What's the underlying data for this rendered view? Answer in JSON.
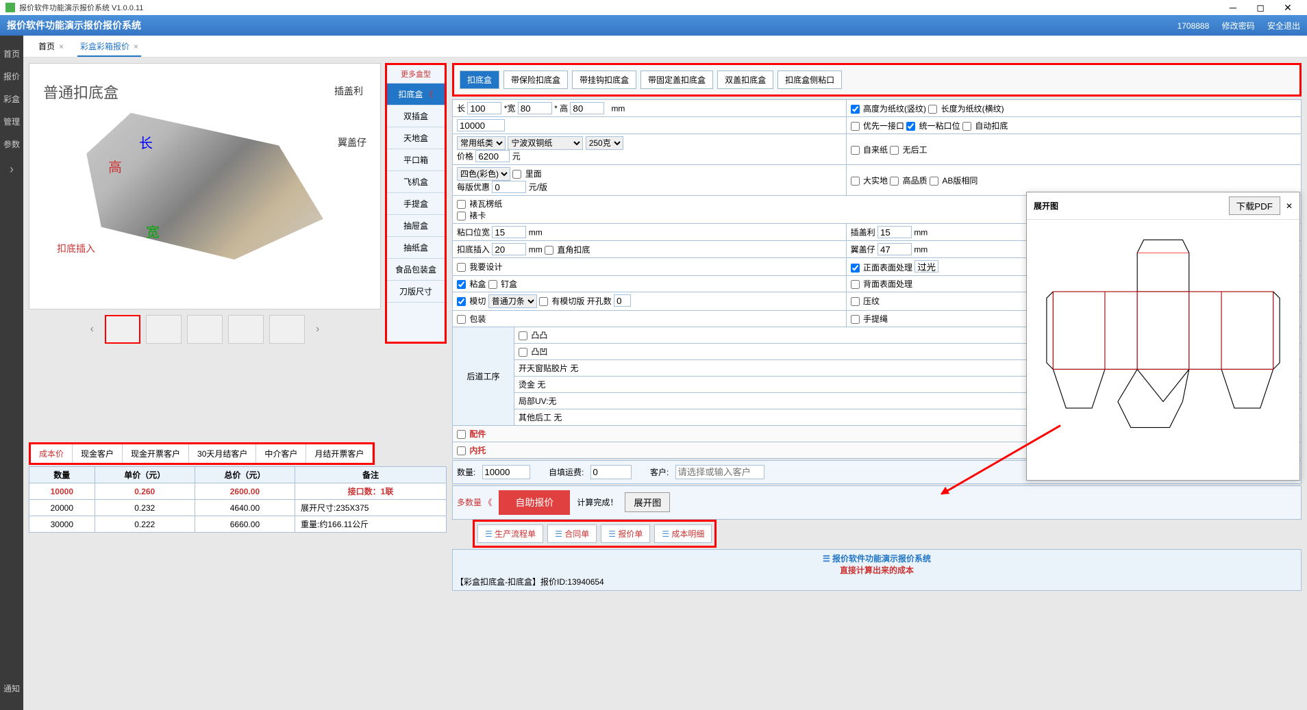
{
  "titlebar": {
    "title": "报价软件功能演示报价系统 V1.0.0.11"
  },
  "header": {
    "brand": "报价软件功能演示报价报价系统",
    "user_id": "1708888",
    "change_pwd": "修改密码",
    "logout": "安全退出"
  },
  "sidebar": {
    "items": [
      "首页",
      "报价",
      "彩盒",
      "管理",
      "参数"
    ],
    "notice": "通知"
  },
  "tabs": [
    {
      "label": "首页",
      "active": false
    },
    {
      "label": "彩盒彩箱报价",
      "active": true
    }
  ],
  "preview": {
    "title": "普通扣底盒",
    "anno_top_right": "插盖利",
    "anno_right": "翼盖仔",
    "anno_length": "长",
    "anno_height": "高",
    "anno_width": "宽",
    "anno_bottom": "扣底插入"
  },
  "box_types": {
    "more": "更多盒型",
    "items": [
      "扣底盒",
      "双插盒",
      "天地盒",
      "平口箱",
      "飞机盒",
      "手提盒",
      "抽屉盒",
      "抽纸盒",
      "食品包装盒",
      "刀版尺寸"
    ],
    "active": 0
  },
  "subtypes": {
    "items": [
      "扣底盒",
      "带保险扣底盒",
      "带挂钩扣底盒",
      "带固定盖扣底盒",
      "双盖扣底盒",
      "扣底盒侧粘口"
    ],
    "active": 0
  },
  "form": {
    "length_label": "长",
    "length": "100",
    "width_label_prefix": "*宽",
    "width": "80",
    "height_label_prefix": "* 高",
    "height": "80",
    "unit_mm": "mm",
    "height_vert": "高度为纸纹(竖纹)",
    "height_horiz": "长度为纸纹(横纹)",
    "qty": "10000",
    "prio_joint": "优先一接口",
    "unify_paste": "统一粘口位",
    "auto_lock": "自动扣底",
    "paper_cat": "常用纸类",
    "paper_name": "宁波双铜纸",
    "paper_weight": "250克",
    "price_label": "价格",
    "price": "6200",
    "price_unit": "元",
    "self_paper": "自来纸",
    "no_post": "无后工",
    "color_sel": "四色(彩色)",
    "inside": "里面",
    "per_orig_disc": "每版优惠",
    "per_orig_val": "0",
    "per_orig_unit": "元/版",
    "big_field": "大实地",
    "hq": "高品质",
    "ab_same": "AB版相同",
    "corrugated": "裱瓦楞纸",
    "mount_card": "裱卡",
    "paste_w_label": "粘口位宽",
    "paste_w": "15",
    "lock_insert_label": "扣底插入",
    "lock_insert": "20",
    "right_angle": "直角扣底",
    "lid_label": "插盖利",
    "lid": "15",
    "wing_label": "翼盖仔",
    "wing": "47",
    "need_design": "我要设计",
    "front_surface": "正面表面处理",
    "front_val": "过光",
    "glue": "粘盒",
    "nail": "钉盒",
    "back_surface": "背面表面处理",
    "diecut": "模切",
    "diecut_sel": "普通刀条",
    "has_die_plate": "有模切版 开孔数",
    "hole_count": "0",
    "emboss": "压纹",
    "packing": "包装",
    "hand_rope": "手提绳",
    "post_label": "后道工序",
    "convex": "凸凸",
    "concave": "凸凹",
    "window_film": "开天窗贴胶片 无",
    "hot_stamp": "烫金 无",
    "partial_uv": "局部UV:无",
    "other_post": "其他后工 无",
    "accessory": "配件",
    "inner_tray": "内托"
  },
  "bottom": {
    "qty_label": "数量:",
    "qty": "10000",
    "ship_label": "自填运费:",
    "ship": "0",
    "customer_label": "客户:",
    "customer_ph": "请选择或输入客户",
    "multi_qty": "多数量",
    "quote_btn": "自助报价",
    "calc_done": "计算完成！",
    "expand_btn": "展开图"
  },
  "customer_tabs": [
    "成本价",
    "现金客户",
    "现金开票客户",
    "30天月结客户",
    "中介客户",
    "月结开票客户"
  ],
  "doc_buttons": [
    "生产流程单",
    "合同单",
    "报价单",
    "成本明细"
  ],
  "results": {
    "headers": [
      "数量",
      "单价（元）",
      "总价（元）",
      "备注"
    ],
    "rows": [
      {
        "qty": "10000",
        "unit": "0.260",
        "total": "2600.00",
        "note": "接口数：1联",
        "hl": true
      },
      {
        "qty": "20000",
        "unit": "0.232",
        "total": "4640.00",
        "note": "展开尺寸:235X375"
      },
      {
        "qty": "30000",
        "unit": "0.222",
        "total": "6660.00",
        "note": "重量:约166.11公斤"
      }
    ],
    "side_title": "报价软件功能演示报价系统",
    "side_sub": "直接计算出来的成本",
    "side_detail": "【彩盒扣底盒-扣底盒】报价ID:13940654"
  },
  "popup": {
    "title": "展开图",
    "pdf_btn": "下载PDF"
  }
}
